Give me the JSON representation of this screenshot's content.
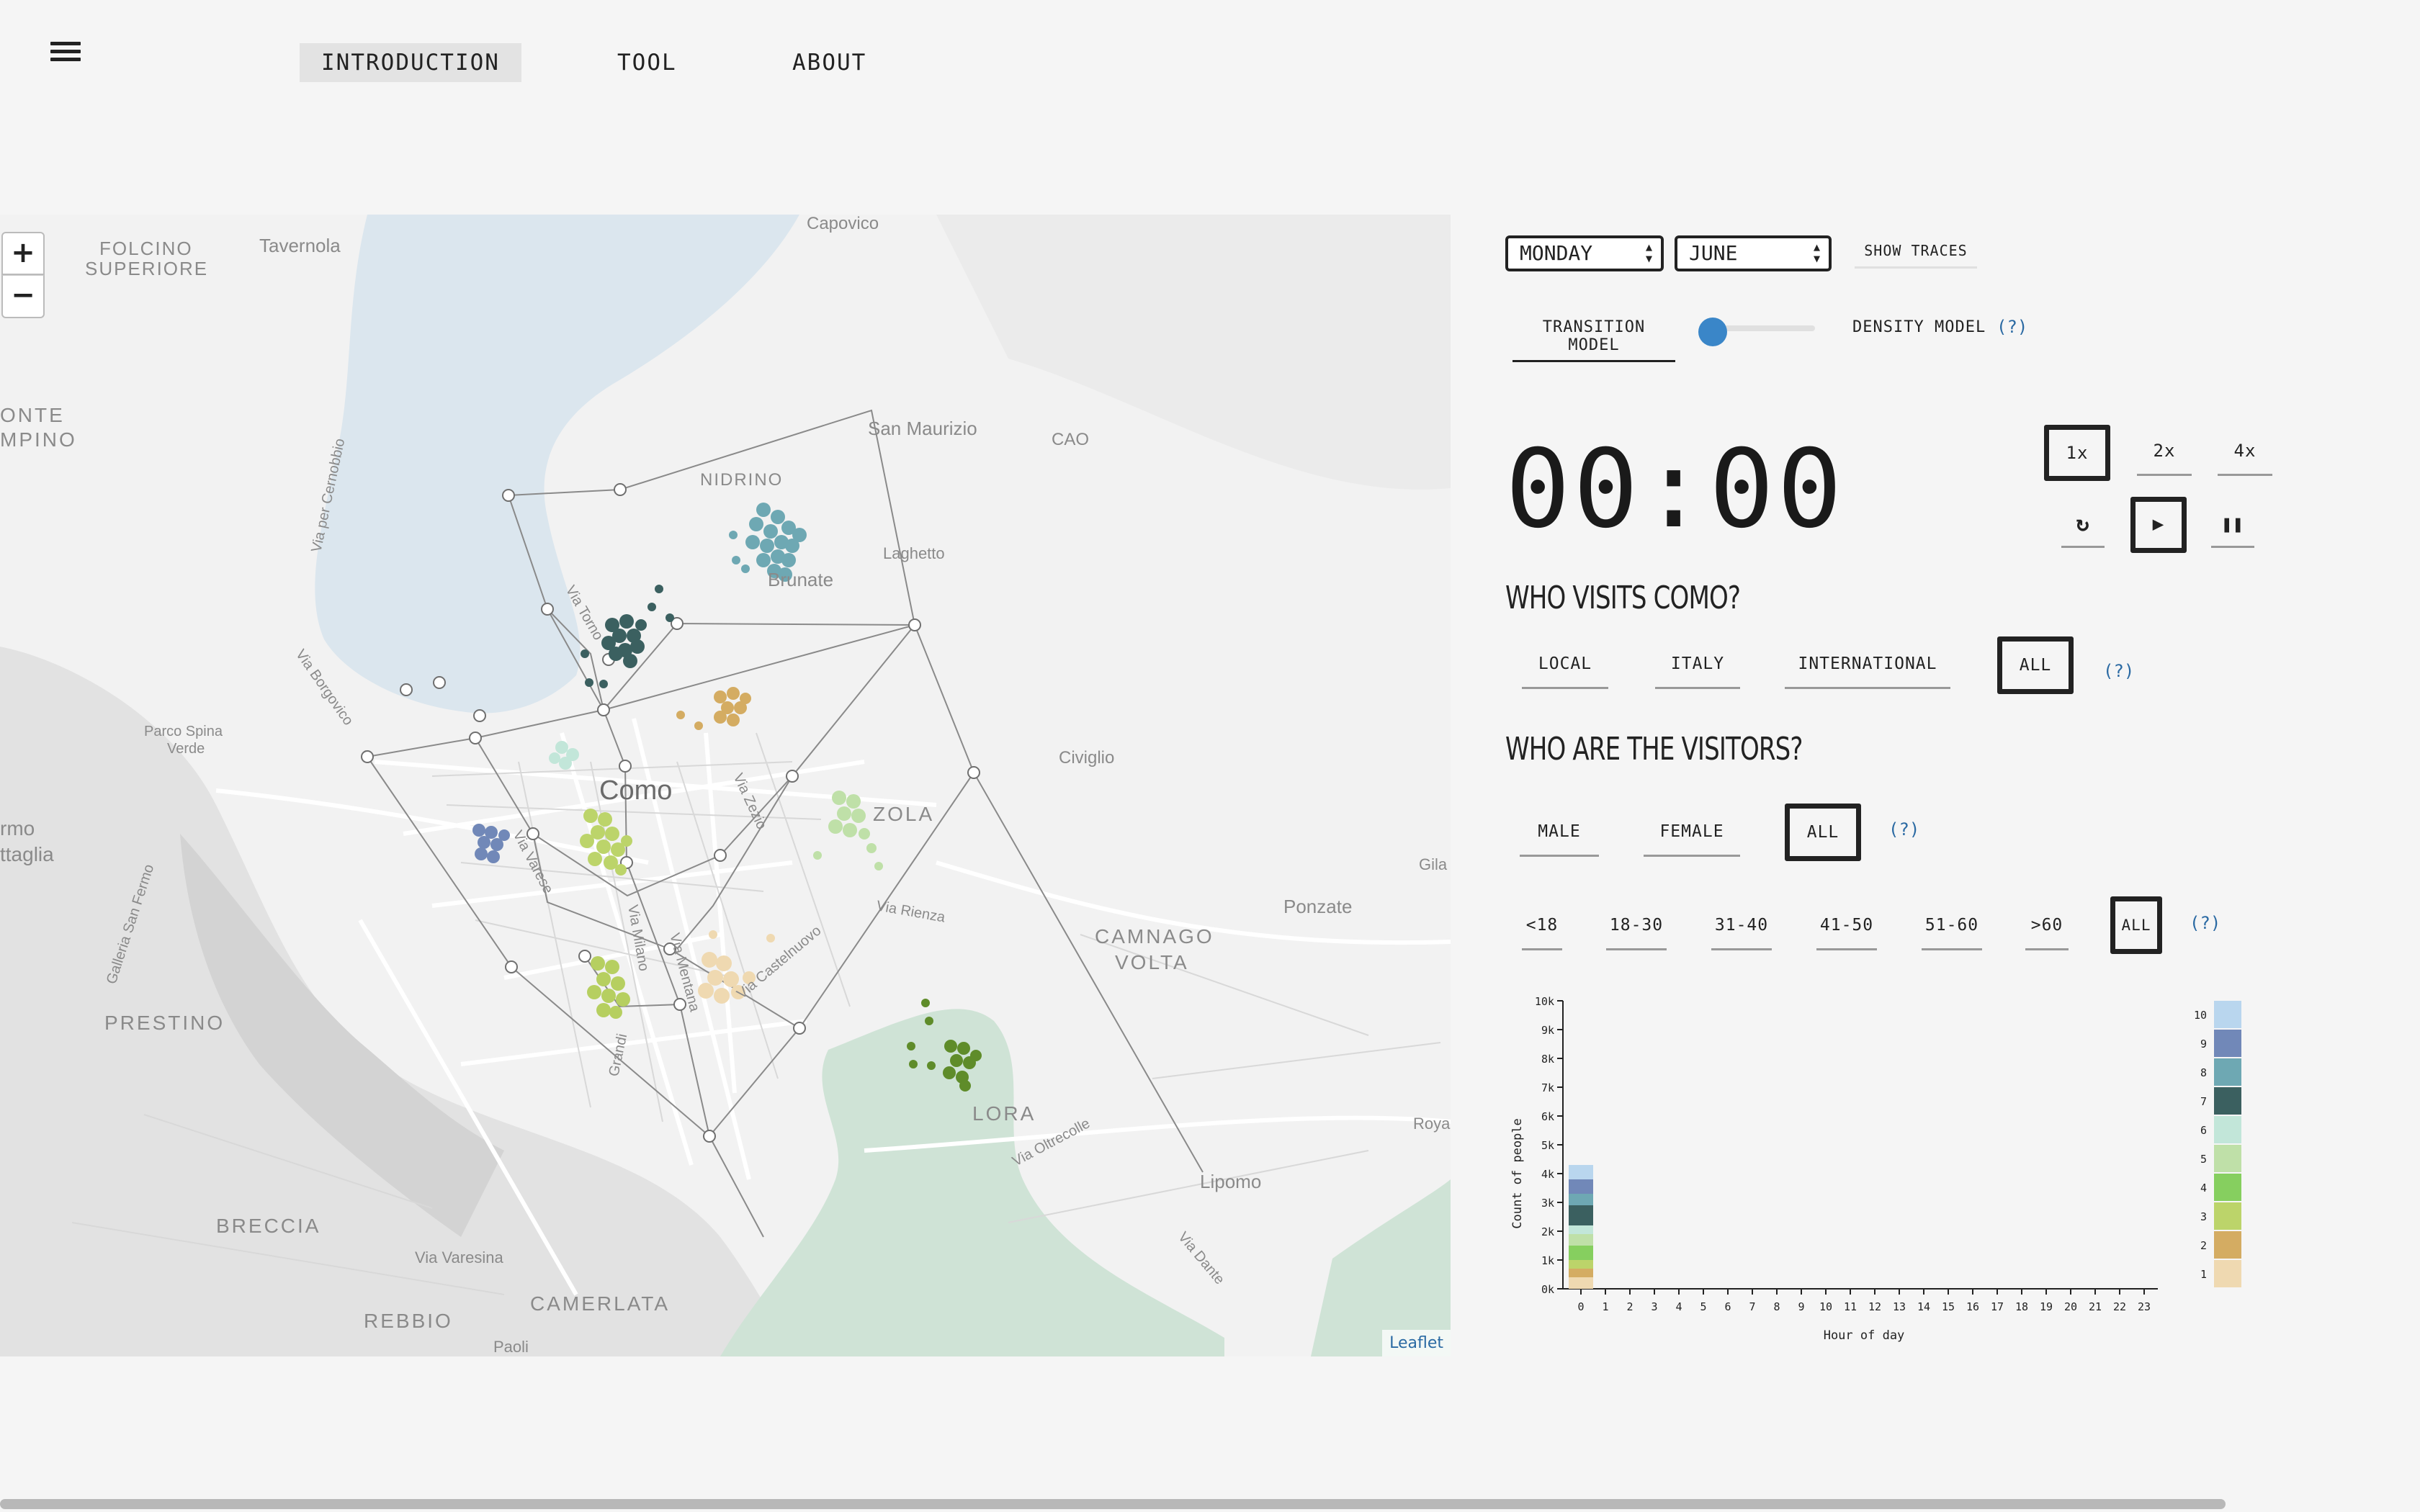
{
  "nav": {
    "menu_icon": "hamburger-icon",
    "items": [
      {
        "label": "INTRODUCTION",
        "active": true
      },
      {
        "label": "TOOL",
        "active": false
      },
      {
        "label": "ABOUT",
        "active": false
      }
    ]
  },
  "map": {
    "zoom_in": "+",
    "zoom_out": "−",
    "attribution": "Leaflet",
    "place_labels": [
      "Capovico",
      "FOLCINO",
      "SUPERIORE",
      "Tavernola",
      "ONTE",
      "MPINO",
      "San Maurizio",
      "CAO",
      "NIDRINO",
      "Laghetto",
      "Brunate",
      "Parco Spina",
      "Verde",
      "Como",
      "ZOLA",
      "Civiglio",
      "rmo",
      "ttaglia",
      "Gila",
      "Ponzate",
      "CAMNAGO",
      "VOLTA",
      "PRESTINO",
      "LORA",
      "Roya",
      "Lipomo",
      "BRECCIA",
      "Via Varesina",
      "CAMERLATA",
      "REBBIO",
      "Paoli",
      "Via per Cernobbio",
      "Via Borgovico",
      "Via Torno",
      "Via Zezio",
      "Via Varese",
      "Via Milano",
      "Via Rienza",
      "Via Castelnuovo",
      "Via Oltrecolle",
      "Via Dante",
      "Galleria San Fermo",
      "Grandi",
      "Via Mentana"
    ],
    "colors": {
      "water": "#dbe6ee",
      "forest": "#cfe3d6",
      "terrain": "#e6e6e6"
    }
  },
  "controls": {
    "day": "MONDAY",
    "month": "JUNE",
    "show_traces": "SHOW TRACES",
    "transition_model": "TRANSITION MODEL",
    "density_model": "DENSITY MODEL",
    "help": "(?)",
    "time": "00:00",
    "speeds": [
      "1x",
      "2x",
      "4x"
    ],
    "selected_speed": "1x",
    "reset_icon": "reset-icon",
    "play_icon": "play-icon",
    "pause_icon": "pause-icon"
  },
  "origin": {
    "title": "WHO VISITS COMO?",
    "options": [
      "LOCAL",
      "ITALY",
      "INTERNATIONAL",
      "ALL"
    ],
    "selected": "ALL"
  },
  "visitors": {
    "title": "WHO ARE THE VISITORS?",
    "gender_options": [
      "MALE",
      "FEMALE",
      "ALL"
    ],
    "gender_selected": "ALL",
    "age_options": [
      "<18",
      "18-30",
      "31-40",
      "41-50",
      "51-60",
      ">60",
      "ALL"
    ],
    "age_selected": "ALL"
  },
  "chart_data": {
    "type": "bar",
    "title": "",
    "xlabel": "Hour of day",
    "ylabel": "Count of people",
    "x": [
      "0",
      "1",
      "2",
      "3",
      "4",
      "5",
      "6",
      "7",
      "8",
      "9",
      "10",
      "11",
      "12",
      "13",
      "14",
      "15",
      "16",
      "17",
      "18",
      "19",
      "20",
      "21",
      "22",
      "23"
    ],
    "y_ticks": [
      "0k",
      "1k",
      "2k",
      "3k",
      "4k",
      "5k",
      "6k",
      "7k",
      "8k",
      "9k",
      "10k"
    ],
    "ylim": [
      0,
      10000
    ],
    "stacked": true,
    "legend_labels": [
      "10",
      "9",
      "8",
      "7",
      "6",
      "5",
      "4",
      "3",
      "2",
      "1"
    ],
    "legend_colors": [
      "#b9d6ee",
      "#7188b8",
      "#6ea8b3",
      "#3b6060",
      "#c2e6d9",
      "#bfe0a8",
      "#86cf5f",
      "#bcd46a",
      "#d4ac62",
      "#efd9b1"
    ],
    "series": [
      {
        "name": "1",
        "values": [
          400,
          0,
          0,
          0,
          0,
          0,
          0,
          0,
          0,
          0,
          0,
          0,
          0,
          0,
          0,
          0,
          0,
          0,
          0,
          0,
          0,
          0,
          0,
          0
        ],
        "color": "#efd9b1"
      },
      {
        "name": "2",
        "values": [
          300,
          0,
          0,
          0,
          0,
          0,
          0,
          0,
          0,
          0,
          0,
          0,
          0,
          0,
          0,
          0,
          0,
          0,
          0,
          0,
          0,
          0,
          0,
          0
        ],
        "color": "#d4ac62"
      },
      {
        "name": "3",
        "values": [
          300,
          0,
          0,
          0,
          0,
          0,
          0,
          0,
          0,
          0,
          0,
          0,
          0,
          0,
          0,
          0,
          0,
          0,
          0,
          0,
          0,
          0,
          0,
          0
        ],
        "color": "#bcd46a"
      },
      {
        "name": "4",
        "values": [
          500,
          0,
          0,
          0,
          0,
          0,
          0,
          0,
          0,
          0,
          0,
          0,
          0,
          0,
          0,
          0,
          0,
          0,
          0,
          0,
          0,
          0,
          0,
          0
        ],
        "color": "#86cf5f"
      },
      {
        "name": "5",
        "values": [
          400,
          0,
          0,
          0,
          0,
          0,
          0,
          0,
          0,
          0,
          0,
          0,
          0,
          0,
          0,
          0,
          0,
          0,
          0,
          0,
          0,
          0,
          0,
          0
        ],
        "color": "#bfe0a8"
      },
      {
        "name": "6",
        "values": [
          300,
          0,
          0,
          0,
          0,
          0,
          0,
          0,
          0,
          0,
          0,
          0,
          0,
          0,
          0,
          0,
          0,
          0,
          0,
          0,
          0,
          0,
          0,
          0
        ],
        "color": "#c2e6d9"
      },
      {
        "name": "7",
        "values": [
          700,
          0,
          0,
          0,
          0,
          0,
          0,
          0,
          0,
          0,
          0,
          0,
          0,
          0,
          0,
          0,
          0,
          0,
          0,
          0,
          0,
          0,
          0,
          0
        ],
        "color": "#3b6060"
      },
      {
        "name": "8",
        "values": [
          400,
          0,
          0,
          0,
          0,
          0,
          0,
          0,
          0,
          0,
          0,
          0,
          0,
          0,
          0,
          0,
          0,
          0,
          0,
          0,
          0,
          0,
          0,
          0
        ],
        "color": "#6ea8b3"
      },
      {
        "name": "9",
        "values": [
          500,
          0,
          0,
          0,
          0,
          0,
          0,
          0,
          0,
          0,
          0,
          0,
          0,
          0,
          0,
          0,
          0,
          0,
          0,
          0,
          0,
          0,
          0,
          0
        ],
        "color": "#7188b8"
      },
      {
        "name": "10",
        "values": [
          500,
          0,
          0,
          0,
          0,
          0,
          0,
          0,
          0,
          0,
          0,
          0,
          0,
          0,
          0,
          0,
          0,
          0,
          0,
          0,
          0,
          0,
          0,
          0
        ],
        "color": "#b9d6ee"
      }
    ]
  }
}
